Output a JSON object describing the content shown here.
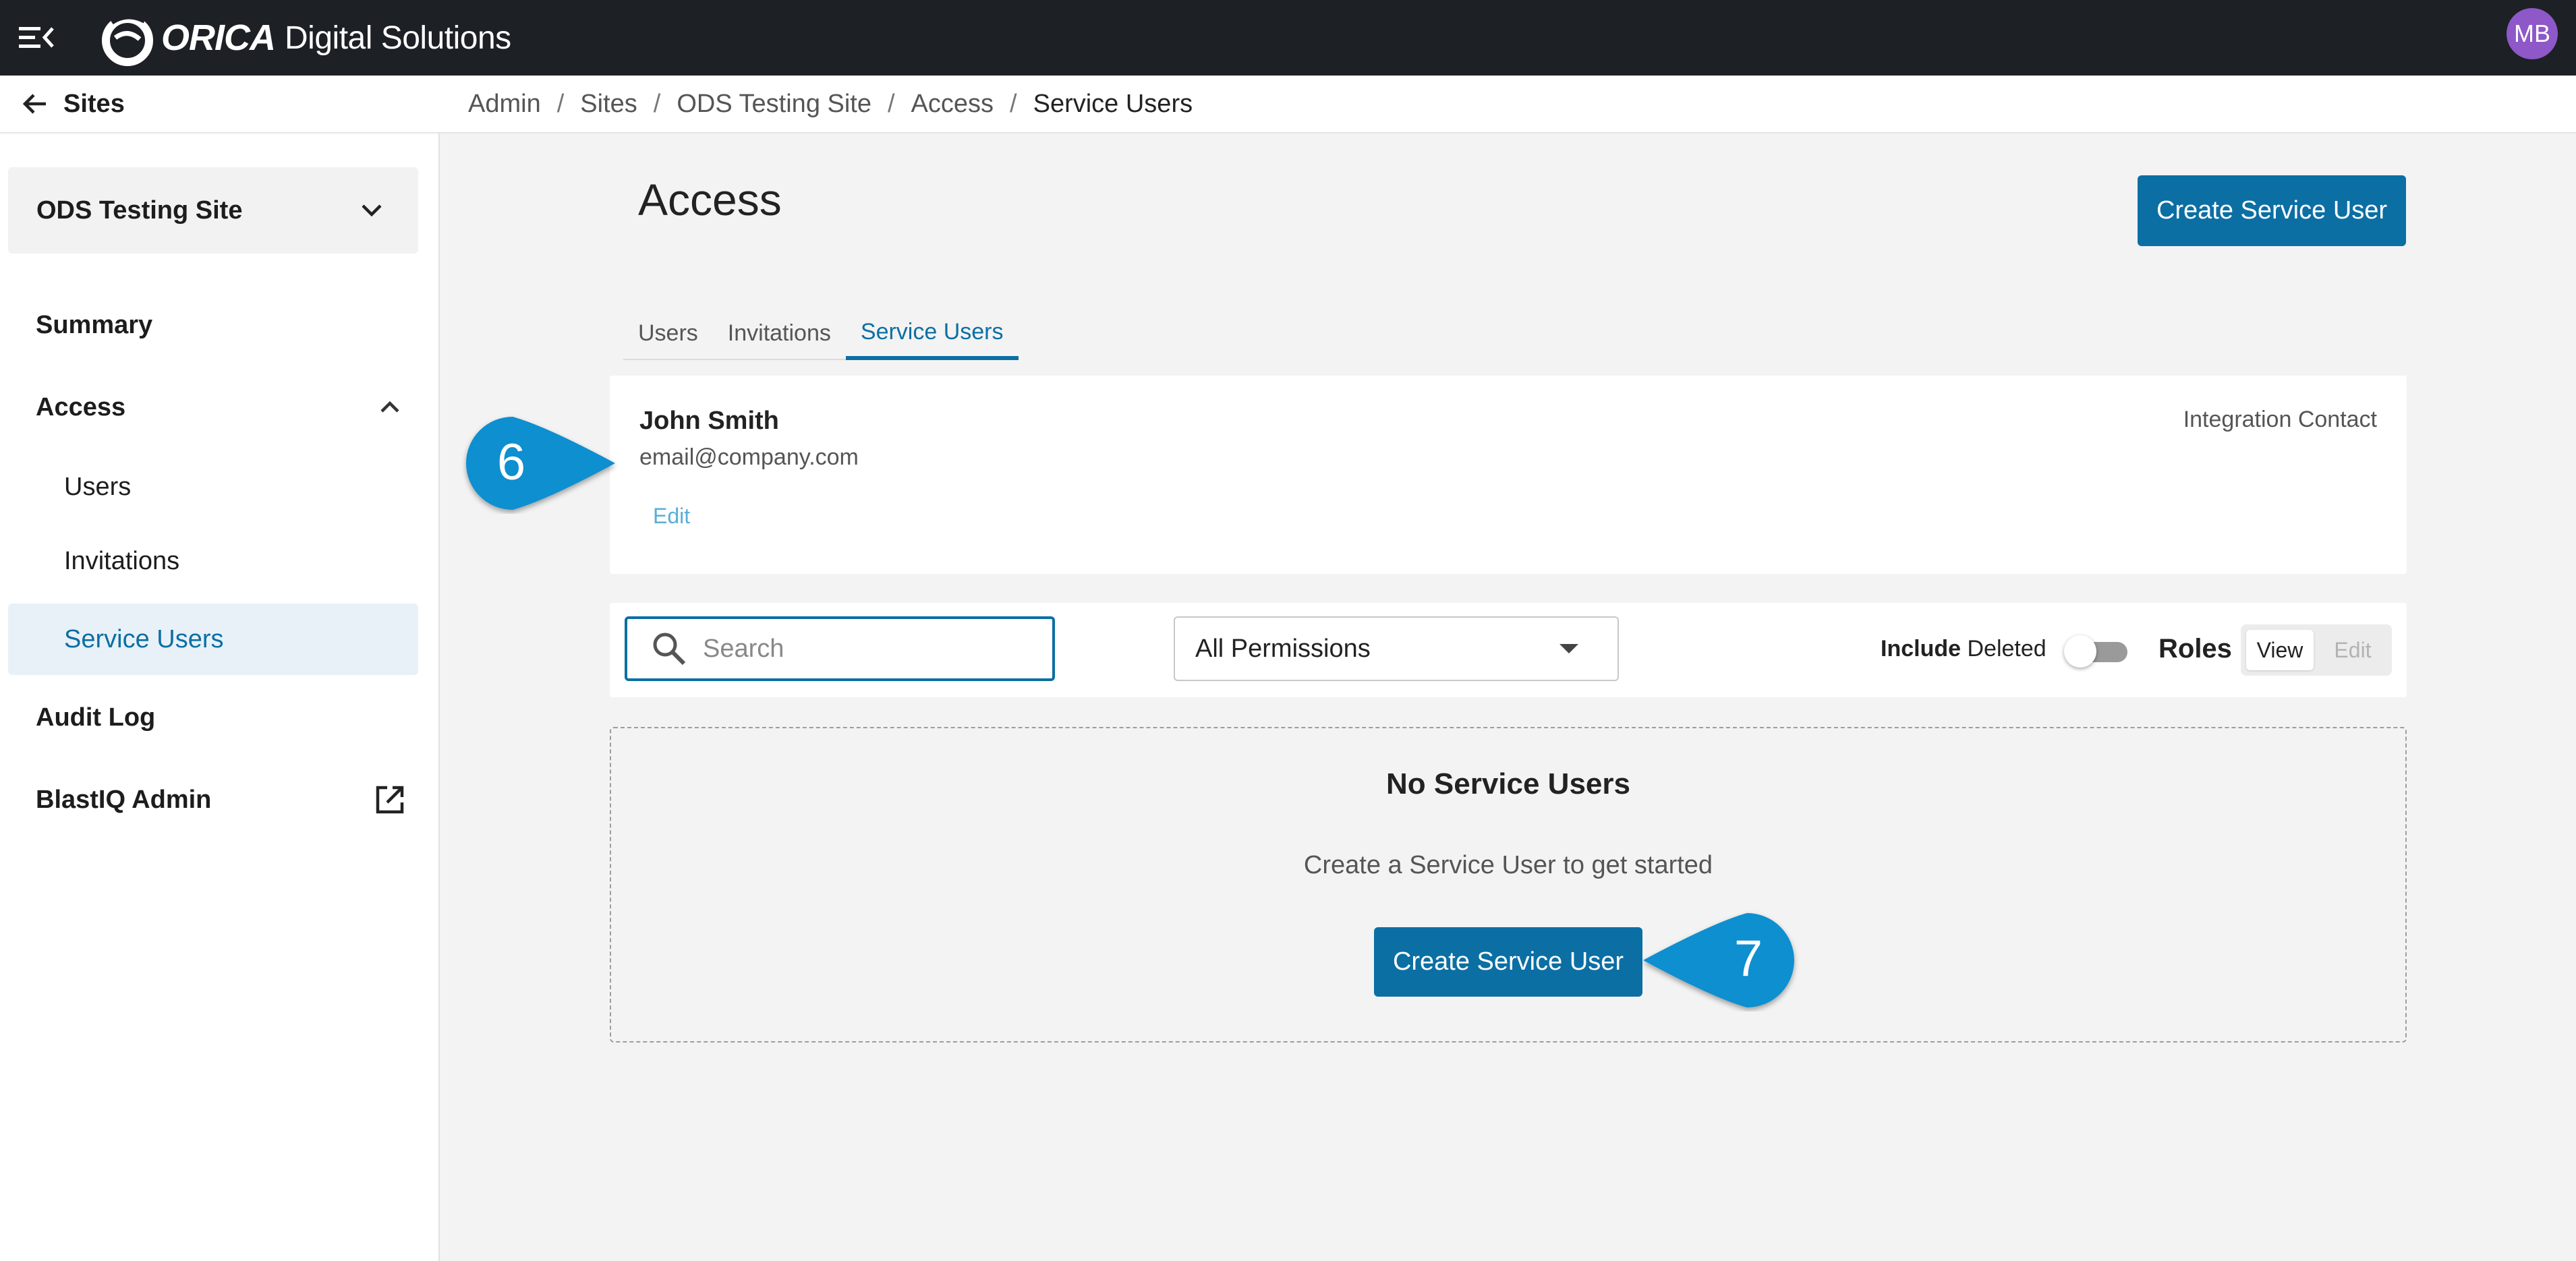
{
  "topbar": {
    "brand": "ORICA",
    "brand_suffix": "Digital Solutions",
    "avatar_initials": "MB"
  },
  "sidebar": {
    "back_label": "Sites",
    "site_selector": "ODS Testing Site",
    "items": [
      {
        "label": "Summary"
      },
      {
        "label": "Access"
      },
      {
        "label": "Users"
      },
      {
        "label": "Invitations"
      },
      {
        "label": "Service Users"
      },
      {
        "label": "Audit Log"
      },
      {
        "label": "BlastIQ Admin"
      }
    ]
  },
  "breadcrumb": [
    "Admin",
    "Sites",
    "ODS Testing Site",
    "Access",
    "Service Users"
  ],
  "breadcrumb_sep": "/",
  "main": {
    "title": "Access",
    "create_button": "Create Service User",
    "tabs": [
      {
        "label": "Users"
      },
      {
        "label": "Invitations"
      },
      {
        "label": "Service Users",
        "active": true
      }
    ]
  },
  "contact_card": {
    "name": "John Smith",
    "email": "email@company.com",
    "edit_label": "Edit",
    "role": "Integration Contact"
  },
  "filters": {
    "search_placeholder": "Search",
    "permissions_value": "All Permissions",
    "include_bold": "Include",
    "include_rest": "Deleted",
    "include_deleted_on": false,
    "roles_label": "Roles",
    "roles_view": "View",
    "roles_edit": "Edit"
  },
  "empty_state": {
    "heading": "No Service Users",
    "text": "Create a Service User to get started",
    "button": "Create Service User"
  },
  "callouts": {
    "first": "6",
    "second": "7",
    "color": "#0a8fd0"
  }
}
